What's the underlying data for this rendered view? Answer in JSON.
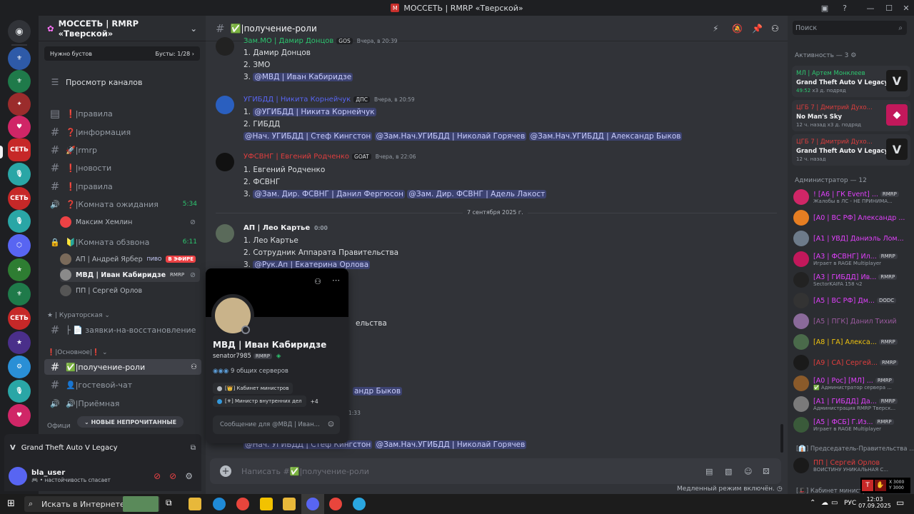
{
  "window": {
    "title": "МОССЕТЬ | RMRP «Тверской»"
  },
  "server": {
    "name": "МОССЕТЬ | RMRP «Тверской»",
    "boost_text": "Нужно бустов",
    "boost_count": "Бусты: 1/28 ›",
    "browse": "Просмотр каналов"
  },
  "channels": [
    {
      "icon": "≡",
      "name": "❗|правила"
    },
    {
      "icon": "#",
      "name": "❓|информация"
    },
    {
      "icon": "#",
      "name": "🚀|rmrp"
    },
    {
      "icon": "#",
      "name": "❗|новости"
    },
    {
      "icon": "#",
      "name": "❗|правила"
    },
    {
      "icon": "🔊",
      "name": "❓|Комната ожидания",
      "count": "5:34"
    },
    {
      "icon": "🔒",
      "name": "🔰|Комната обзвона",
      "count": "6:11"
    },
    {
      "icon": "#",
      "name": "├ 📄 заявки-на-восстановление"
    },
    {
      "icon": "#",
      "name": "✅|получение-роли"
    },
    {
      "icon": "#",
      "name": "👤|гостевой-чат"
    },
    {
      "icon": "🔊",
      "name": "🔊|Приёмная"
    }
  ],
  "voice_users": {
    "waiting": [
      "Максим Хемлин"
    ],
    "review": [
      {
        "name": "АП | Андрей Ярбер",
        "tag": "ПИВО",
        "live": "В ЭФИРЕ"
      },
      {
        "name": "МВД | Иван Кабиридзе",
        "tag": "RMRP"
      },
      {
        "name": "ПП | Сергей Орлов"
      }
    ]
  },
  "categories": {
    "curator": "★ | Кураторская ⌄",
    "main": "❗|Основное|❗ ⌄",
    "office": "Офици"
  },
  "unread_pill": "⌄ НОВЫЕ НЕПРОЧИТАННЫЕ",
  "activity": {
    "game": "Grand Theft Auto V Legacy"
  },
  "user": {
    "name": "bla_user",
    "status": "🎮 • настойчивость спасает"
  },
  "channel": {
    "title": "✅|получение-роли",
    "placeholder": "Написать #✅|получение-роли",
    "slowmode": "Медленный режим включён."
  },
  "messages": [
    {
      "author": "Зам.МО | Дамир Донцов",
      "color": "#2dc770",
      "tag": "GOS",
      "time": "Вчера, в 20:39",
      "lines": [
        "1. Дамир Донцов",
        "2. ЗМО"
      ],
      "mention_line": [
        "@МВД | Иван Кабиридзе"
      ],
      "prefix": "3. "
    },
    {
      "author": "УГИБДД | Никита Корнейчук",
      "color": "#5865f2",
      "tag": "ДПС",
      "time": "Вчера, в 20:59",
      "lines": [
        "1. @УГИБДД | Никита Корнейчук",
        "2. ГИБДД"
      ],
      "mention_line": [
        "@Нач. УГИБДД | Стеф Кингстон",
        "@Зам.Нач.УГИБДД | Николай Горячев",
        "@Зам.Нач.УГИБДД | Александр Быков"
      ],
      "prefix": ""
    },
    {
      "author": "УФСВНГ | Евгений Родченко",
      "color": "#e03e3e",
      "tag": "GOAT",
      "time": "Вчера, в 22:06",
      "lines": [
        "1. Евгений Родченко",
        "2. ФСВНГ"
      ],
      "mention_line": [
        "@Зам. Дир. ФСВНГ | Данил Фергюсон",
        "@Зам. Дир. ФСВНГ | Адель Лакост"
      ],
      "prefix": "3. "
    },
    {
      "author": "АП | Лео Картье",
      "color": "#f2f3f5",
      "tag": "",
      "time": "0:00",
      "lines": [
        "1. Лео Картье",
        "2. Сотрудник Аппарата Правительства"
      ],
      "mention_line": [
        "@Рук.Ап | Екатерина Орлова"
      ],
      "prefix": "3. "
    }
  ],
  "date_divider": "7 сентября 2025 г.",
  "partial": {
    "p1": "ельства",
    "p2": "андр Быков",
    "p3": "1:33",
    "p4": "@Нач. УГИБДД | Стеф Кингстон",
    "p5": "@Зам.Нач.УГИБДД | Николай Горячев"
  },
  "popup": {
    "name": "МВД | Иван Кабиридзе",
    "username": "senator7985",
    "tag": "RMRP",
    "mutual": "9 общих серверов",
    "role1": "[👑] Кабинет министров",
    "role2": "[⚜] Министр внутренних дел",
    "more": "+4",
    "placeholder": "Сообщение для @МВД | Иван..."
  },
  "members": {
    "search": "Поиск",
    "activity_header": "Активность — 3",
    "activities": [
      {
        "name": "МЛ | Артем Монклеев",
        "game": "Grand Theft Auto V Legacy",
        "time": "49:52",
        "sub": "x3 д. подряд",
        "color": "#2dc770"
      },
      {
        "name": "ЦГБ 7 | Дмитрий Духо...",
        "game": "No Man's Sky",
        "time": "12 ч. назад",
        "sub": "x3 д. подряд",
        "color": "#e03e3e"
      },
      {
        "name": "ЦГБ 7 | Дмитрий Духо...",
        "game": "Grand Theft Auto V Legacy",
        "time": "12 ч. назад",
        "sub": "",
        "color": "#e03e3e"
      }
    ],
    "admin_header": "Администратор — 12",
    "admins": [
      {
        "name": "! [A6 | ГК Event] ...",
        "sub": "Жалобы в ЛС - НЕ ПРИНИМА...",
        "badge": "RMRP",
        "color": "#e040fb"
      },
      {
        "name": "[A0 | ВС РФ] Александр ...",
        "sub": "",
        "badge": "",
        "color": "#e040fb"
      },
      {
        "name": "[A1 | УВД] Даниэль Лом...",
        "sub": "",
        "badge": "",
        "color": "#e040fb"
      },
      {
        "name": "[A3 | ФСВНГ] Ил...",
        "sub": "Играет в RAGE Multiplayer",
        "badge": "RMRP",
        "color": "#e040fb"
      },
      {
        "name": "[A3 | ГИБДД] Ив...",
        "sub": "SectorKAIFA 158 ч2",
        "badge": "RMRP",
        "color": "#e040fb"
      },
      {
        "name": "[A5 | ВС РФ] Дм...",
        "sub": "",
        "badge": "DODC",
        "color": "#e040fb"
      },
      {
        "name": "[A5 | ПГК] Данил Тихий",
        "sub": "",
        "badge": "",
        "color": "#9a5a9e"
      },
      {
        "name": "[A8 | ГА] Алекса...",
        "sub": "",
        "badge": "RMRP",
        "color": "#f1c40f"
      },
      {
        "name": "[A9 | CA] Сергей...",
        "sub": "",
        "badge": "RMRP",
        "color": "#e03e3e"
      },
      {
        "name": "[A0 | Рос] [МЛ] ...",
        "sub": "✅ Администратор сервера ...",
        "badge": "RMRP",
        "color": "#e040fb"
      },
      {
        "name": "[A1 | ГИБДД] Да...",
        "sub": "Администрация RMRP Тверск...",
        "badge": "RMRP",
        "color": "#e040fb"
      },
      {
        "name": "[A5 | ФСБ] Г.Из...",
        "sub": "Играет в RAGE Multiplayer",
        "badge": "RMRP",
        "color": "#e040fb"
      }
    ],
    "chair_header": "[👔] Председатель-Правительства ...",
    "chair": {
      "name": "ПП | Сергей Орлов",
      "sub": "ВОИСТИНУ УНИКАЛЬНАЯ С..."
    },
    "cabinet_header": "[🎩] Кабинет министр..."
  },
  "overlay": {
    "x": "X 3000",
    "y": "Y 3000"
  },
  "taskbar": {
    "search": "Искать в Интернете &",
    "lang": "РУС",
    "time": "12:03",
    "date": "07.09.2025"
  }
}
